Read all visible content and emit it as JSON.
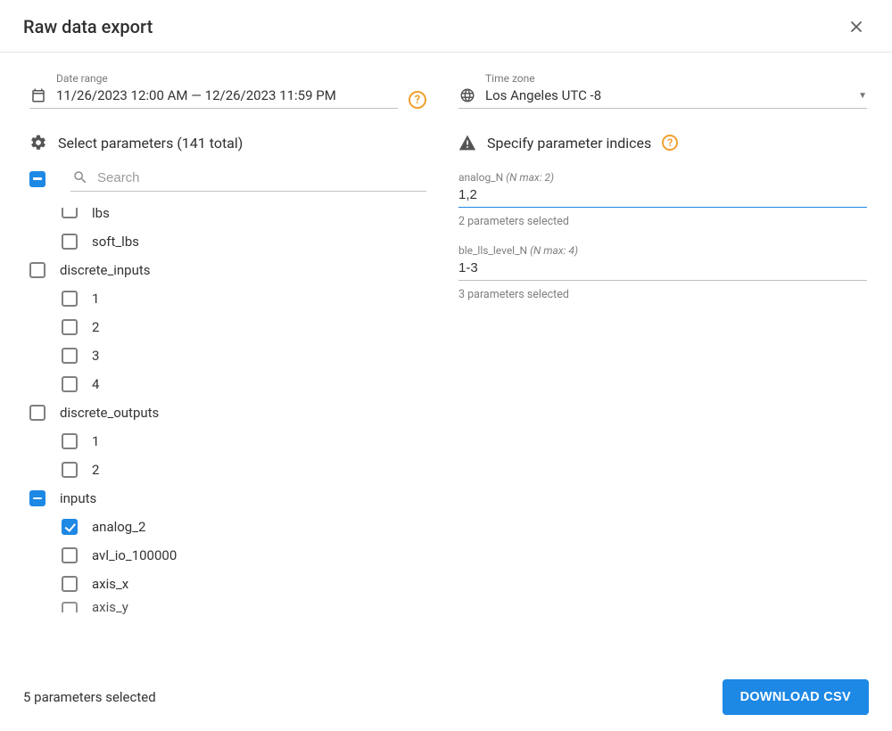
{
  "title": "Raw data export",
  "date_range": {
    "label": "Date range",
    "value": "11/26/2023 12:00 AM — 12/26/2023 11:59 PM"
  },
  "time_zone": {
    "label": "Time zone",
    "value": "Los Angeles UTC -8"
  },
  "select_params": {
    "heading": "Select parameters (141 total)",
    "search_placeholder": "Search",
    "tree": [
      {
        "type": "child",
        "label": "lbs",
        "state": "cut-top"
      },
      {
        "type": "child",
        "label": "soft_lbs",
        "state": "unchecked"
      },
      {
        "type": "group",
        "label": "discrete_inputs",
        "state": "unchecked"
      },
      {
        "type": "child",
        "label": "1",
        "state": "unchecked"
      },
      {
        "type": "child",
        "label": "2",
        "state": "unchecked"
      },
      {
        "type": "child",
        "label": "3",
        "state": "unchecked"
      },
      {
        "type": "child",
        "label": "4",
        "state": "unchecked"
      },
      {
        "type": "group",
        "label": "discrete_outputs",
        "state": "unchecked"
      },
      {
        "type": "child",
        "label": "1",
        "state": "unchecked"
      },
      {
        "type": "child",
        "label": "2",
        "state": "unchecked"
      },
      {
        "type": "group",
        "label": "inputs",
        "state": "indet"
      },
      {
        "type": "child",
        "label": "analog_2",
        "state": "checked"
      },
      {
        "type": "child",
        "label": "avl_io_100000",
        "state": "unchecked"
      },
      {
        "type": "child",
        "label": "axis_x",
        "state": "unchecked"
      },
      {
        "type": "child",
        "label": "axis_y",
        "state": "cut-bottom"
      }
    ]
  },
  "indices": {
    "heading": "Specify parameter indices",
    "fields": [
      {
        "label": "analog_N",
        "hint": "(N max: 2)",
        "value": "1,2",
        "status": "2 parameters selected",
        "focused": true
      },
      {
        "label": "ble_lls_level_N",
        "hint": "(N max: 4)",
        "value": "1-3",
        "status": "3 parameters selected",
        "focused": false
      }
    ]
  },
  "footer": {
    "status": "5 parameters selected",
    "button": "DOWNLOAD CSV"
  }
}
